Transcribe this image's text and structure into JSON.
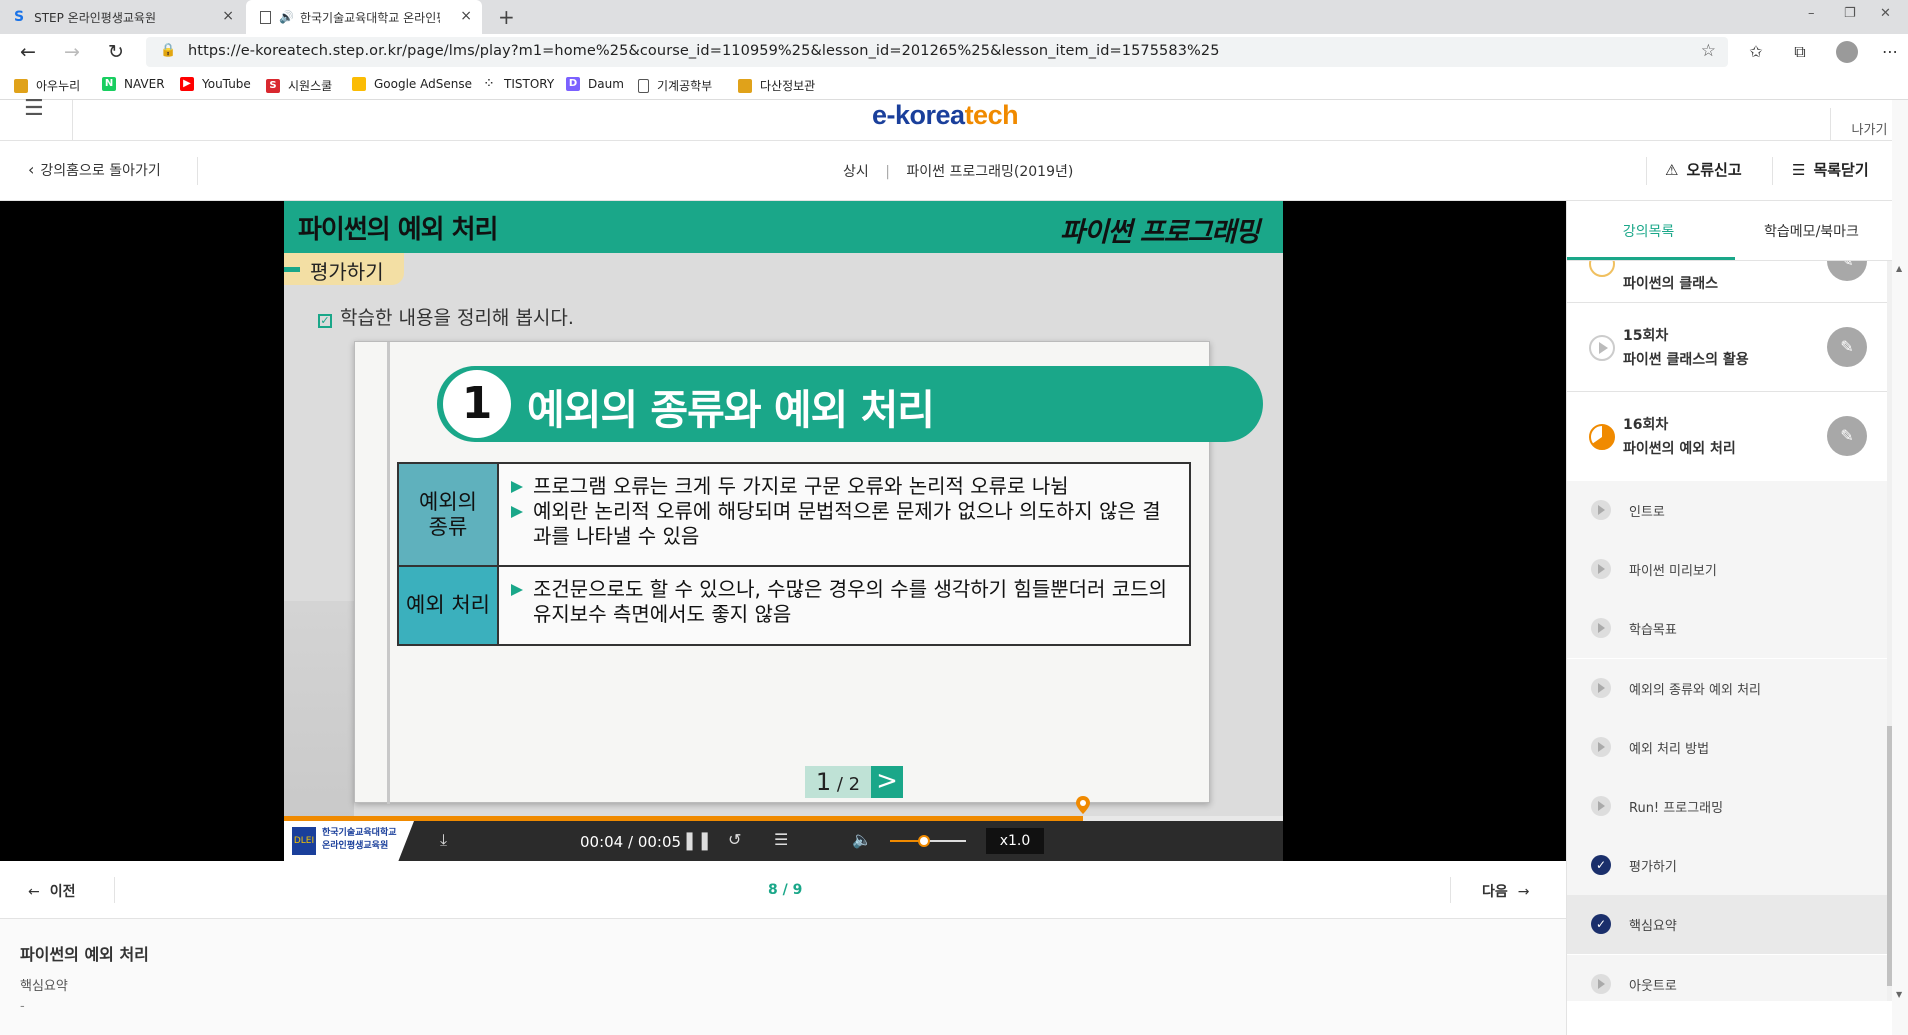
{
  "browser": {
    "tabs": [
      {
        "title": "STEP 온라인평생교육원",
        "close": "×"
      },
      {
        "title": "한국기술교육대학교 온라인평생교육원",
        "close": "×"
      }
    ],
    "new_tab": "+",
    "window_controls": {
      "minimize": "–",
      "maximize": "❐",
      "close": "✕"
    },
    "url": "https://e-koreatech.step.or.kr/page/lms/play?m1=home%25&course_id=110959%25&lesson_id=201265%25&lesson_item_id=1575583%25",
    "bookmarks": [
      {
        "label": "아우누리",
        "color": "#e0a21a"
      },
      {
        "label": "NAVER",
        "color": "#19ce60"
      },
      {
        "label": "YouTube",
        "color": "#ff0000"
      },
      {
        "label": "시원스쿨",
        "color": "#d9282f"
      },
      {
        "label": "Google AdSense",
        "color": "#fbbc04"
      },
      {
        "label": "TISTORY",
        "color": "#333333"
      },
      {
        "label": "Daum",
        "color": "#7b61ff"
      },
      {
        "label": "기계공학부",
        "color": "#777777"
      },
      {
        "label": "다산정보관",
        "color": "#e0a21a"
      }
    ]
  },
  "header": {
    "logo_main": "e-korea",
    "logo_accent": "tech",
    "exit_label": "나가기"
  },
  "subheader": {
    "back_label": "강의홈으로 돌아가기",
    "category": "상시",
    "separator": "|",
    "course_title": "파이썬 프로그래밍(2019년)",
    "report_label": "오류신고",
    "close_list_label": "목록닫기"
  },
  "slide": {
    "title": "파이썬의 예외 처리",
    "brand": "파이썬 프로그래밍",
    "section_tag": "평가하기",
    "instruction": "학습한 내용을 정리해 봅시다.",
    "topic_number": "1",
    "topic_title": "예외의 종류와 예외 처리",
    "table": [
      {
        "head_line1": "예외의",
        "head_line2": "종류",
        "bullets": [
          "프로그램 오류는 크게 두 가지로 구문 오류와 논리적 오류로 나뉨",
          "예외란 논리적 오류에 해당되며 문법적으론 문제가 없으나 의도하지 않은 결과를 나타낼 수 있음"
        ]
      },
      {
        "head_line1": "예외 처리",
        "head_line2": "",
        "bullets": [
          "조건문으로도 할 수 있으나, 수많은 경우의 수를 생각하기 힘들뿐더러 코드의 유지보수 측면에서도 좋지 않음"
        ]
      }
    ],
    "page_current": "1",
    "page_total": "2",
    "page_next": ">"
  },
  "player": {
    "progress": 0.8,
    "time": "00:04 / 00:05",
    "volume": 0.45,
    "speed": "x1.0",
    "logo_line1": "한국기술교육대학교",
    "logo_line2": "온라인평생교육원",
    "logo_mark": "DLEI"
  },
  "lesson_nav": {
    "prev_label": "이전",
    "next_label": "다음",
    "page_count": "8 / 9"
  },
  "lesson_info": {
    "title": "파이썬의 예외 처리",
    "item": "핵심요약",
    "dash": "-"
  },
  "sidebar": {
    "tabs": [
      "강의목록",
      "학습메모/북마크"
    ],
    "chapters": [
      {
        "no": "",
        "name": "파이썬의 클래스"
      },
      {
        "no": "15회차",
        "name": "파이썬 클래스의 활용"
      },
      {
        "no": "16회차",
        "name": "파이썬의 예외 처리"
      }
    ],
    "items": [
      {
        "label": "인트로",
        "done": false
      },
      {
        "label": "파이썬 미리보기",
        "done": false
      },
      {
        "label": "학습목표",
        "done": false
      },
      {
        "label": "예외의 종류와 예외 처리",
        "done": false
      },
      {
        "label": "예외 처리 방법",
        "done": false
      },
      {
        "label": "Run! 프로그래밍",
        "done": false
      },
      {
        "label": "평가하기",
        "done": true
      },
      {
        "label": "핵심요약",
        "done": true
      },
      {
        "label": "아웃트로",
        "done": false
      }
    ],
    "colors": {
      "accent": "#1aa789",
      "done": "#1a2f6b",
      "inprogress": "#f08a00"
    }
  }
}
